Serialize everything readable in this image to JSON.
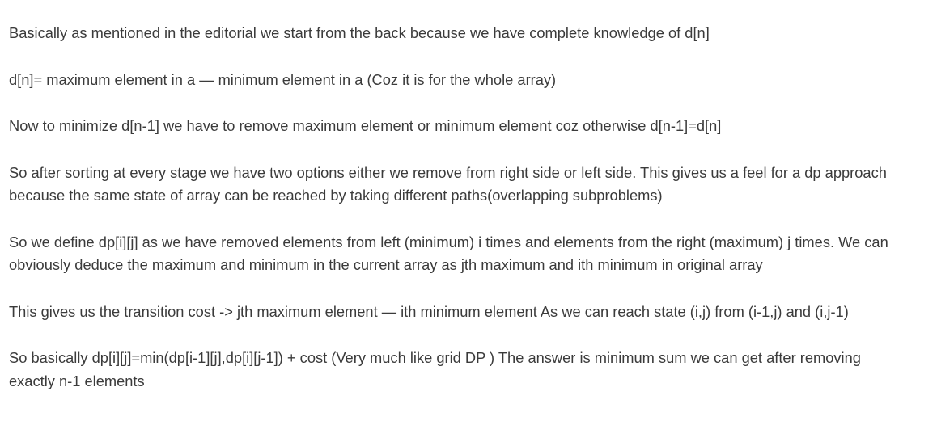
{
  "post": {
    "paragraphs": [
      "Basically as mentioned in the editorial we start from the back because we have complete knowledge of d[n]",
      "d[n]= maximum element in a — minimum element in a (Coz it is for the whole array)",
      "Now to minimize d[n-1] we have to remove maximum element or minimum element coz otherwise d[n-1]=d[n]",
      "So after sorting at every stage we have two options either we remove from right side or left side. This gives us a feel for a dp approach because the same state of array can be reached by taking different paths(overlapping subproblems)",
      "So we define dp[i][j] as we have removed elements from left (minimum) i times and elements from the right (maximum) j times. We can obviously deduce the maximum and minimum in the current array as jth maximum and ith minimum in original array",
      "This gives us the transition cost -> jth maximum element — ith minimum element As we can reach state (i,j) from (i-1,j) and (i,j-1)",
      "So basically dp[i][j]=min(dp[i-1][j],dp[i][j-1]) + cost (Very much like grid DP ) The answer is minimum sum we can get after removing exactly n-1 elements"
    ]
  }
}
